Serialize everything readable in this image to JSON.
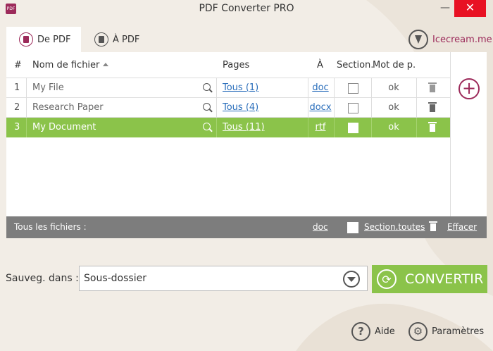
{
  "window": {
    "title": "PDF Converter PRO",
    "app_icon": "pdf-app-icon",
    "minimize_glyph": "—",
    "close_glyph": "✕"
  },
  "tabs": [
    {
      "label": "De PDF",
      "icon": "from-pdf-icon",
      "active": true
    },
    {
      "label": "À PDF",
      "icon": "to-pdf-icon",
      "active": false
    }
  ],
  "brand": {
    "label": "Icecream.me",
    "icon": "icecream-cone-icon"
  },
  "table": {
    "headers": {
      "num": "#",
      "filename": "Nom de fichier",
      "pages": "Pages",
      "to": "À",
      "section": "Section.",
      "password": "Mot de p."
    },
    "rows": [
      {
        "num": "1",
        "filename": "My File",
        "pages": "Tous (1)",
        "format": "doc",
        "password": "ok",
        "selected": false
      },
      {
        "num": "2",
        "filename": "Research Paper",
        "pages": "Tous (4)",
        "format": "docx",
        "password": "ok",
        "selected": false
      },
      {
        "num": "3",
        "filename": "My Document",
        "pages": "Tous (11)",
        "format": "rtf",
        "password": "ok",
        "selected": true
      }
    ]
  },
  "footer": {
    "label": "Tous les fichiers :",
    "format": "doc",
    "section_all": "Section.toutes",
    "clear": "Effacer"
  },
  "save": {
    "label": "Sauveg. dans :",
    "value": "Sous-dossier"
  },
  "convert_label": "CONVERTIR",
  "help_label": "Aide",
  "help_glyph": "?",
  "settings_label": "Paramètres",
  "settings_glyph": "⚙",
  "add_glyph": "+",
  "convert_glyph": "⟳",
  "colors": {
    "accent": "#9c2a5a",
    "selected_row": "#8bc34a",
    "convert_button": "#8bc34a",
    "footer_bar": "#7d7d7d",
    "close_button": "#e81123"
  }
}
